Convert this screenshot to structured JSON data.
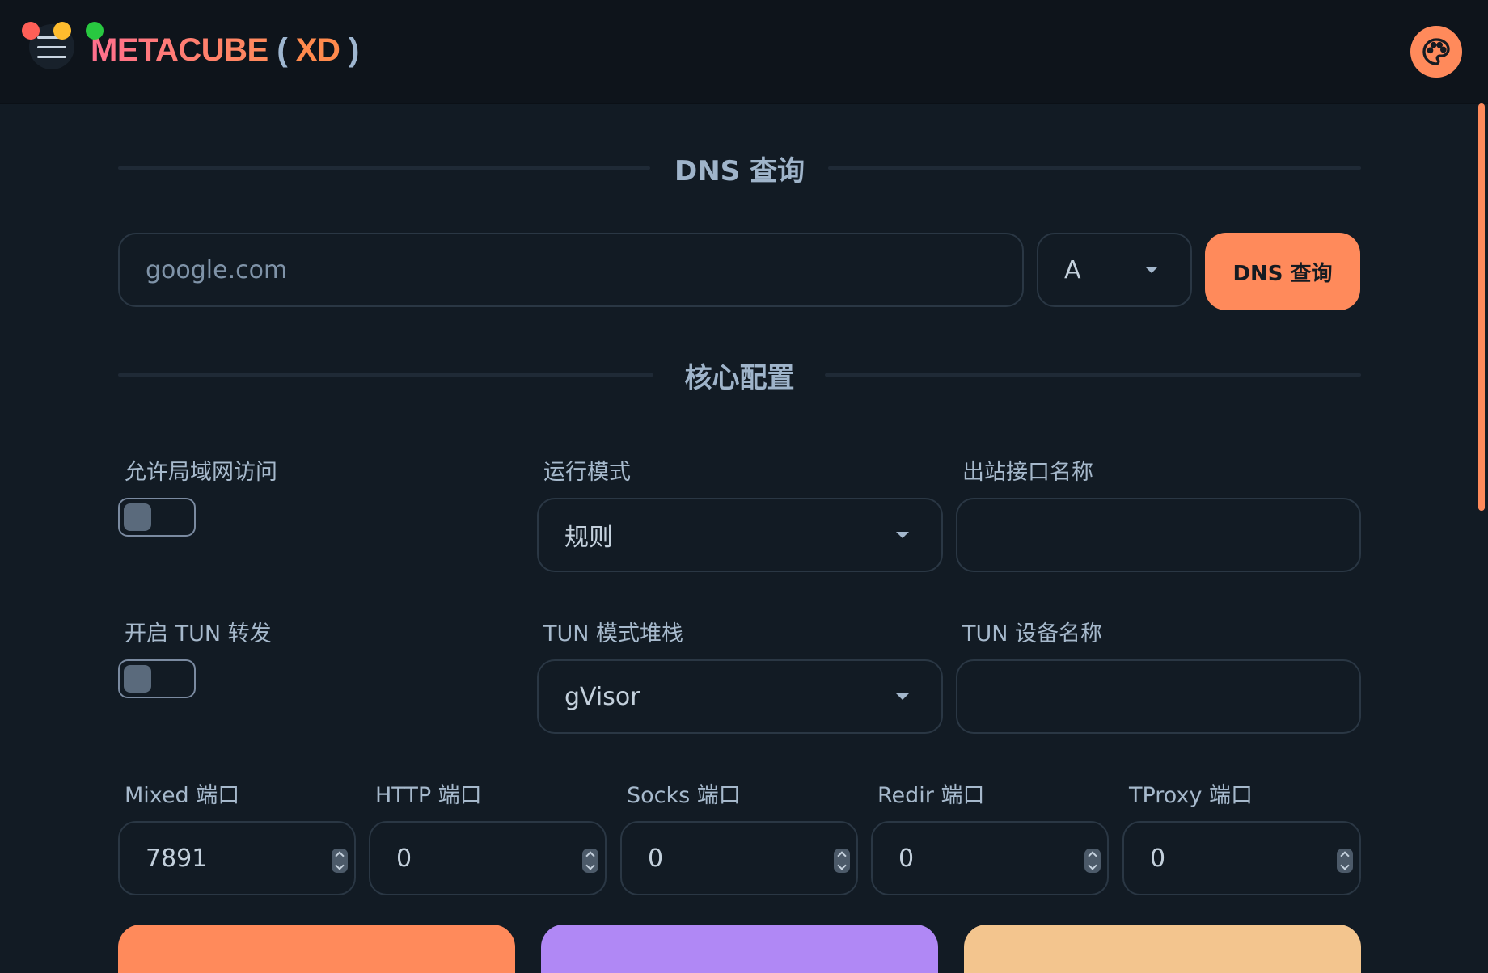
{
  "app": {
    "brand_name": "METACUBE",
    "brand_paren_open": "(",
    "brand_suffix": "XD",
    "brand_paren_close": ")"
  },
  "colors": {
    "accent": "#ff8a5b",
    "purple": "#b088f5",
    "peach": "#f3c58e",
    "background": "#121b24"
  },
  "icons": {
    "menu": "hamburger-icon",
    "theme": "palette-icon",
    "dropdown": "chevron-down-icon"
  },
  "dns": {
    "section_title": "DNS 查询",
    "input_placeholder": "google.com",
    "record_type": "A",
    "query_button": "DNS 查询"
  },
  "core": {
    "section_title": "核心配置",
    "allow_lan_label": "允许局域网访问",
    "allow_lan": false,
    "mode_label": "运行模式",
    "mode_value": "规则",
    "interface_label": "出站接口名称",
    "interface_value": "",
    "tun_label": "开启 TUN 转发",
    "tun_enabled": false,
    "tun_stack_label": "TUN 模式堆栈",
    "tun_stack_value": "gVisor",
    "tun_device_label": "TUN 设备名称",
    "tun_device_value": "",
    "ports": [
      {
        "label": "Mixed 端口",
        "value": "7891"
      },
      {
        "label": "HTTP 端口",
        "value": "0"
      },
      {
        "label": "Socks 端口",
        "value": "0"
      },
      {
        "label": "Redir 端口",
        "value": "0"
      },
      {
        "label": "TProxy 端口",
        "value": "0"
      }
    ]
  }
}
